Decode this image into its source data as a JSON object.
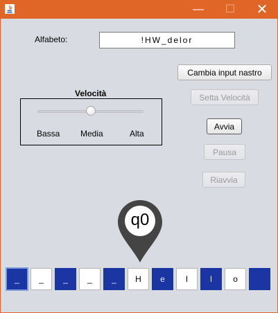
{
  "window": {
    "minimize_glyph": "—",
    "maximize_glyph": "☐",
    "close_glyph": "✕",
    "titlebar_color": "#e06627"
  },
  "alphabet": {
    "label": "Alfabeto:",
    "value": "!HW_delor"
  },
  "buttons": {
    "change_tape": "Cambia input nastro",
    "set_speed": "Setta Velocità",
    "start": "Avvia",
    "pause": "Pausa",
    "restart": "Riavvia"
  },
  "speed": {
    "title": "Velocità",
    "low": "Bassa",
    "medium": "Media",
    "high": "Alta",
    "level_fraction": 0.5
  },
  "state": {
    "name": "q0",
    "pin_color": "#444444"
  },
  "tape": {
    "cells": [
      {
        "symbol": "_",
        "style": "blue",
        "active": true
      },
      {
        "symbol": "_",
        "style": "white",
        "active": false
      },
      {
        "symbol": "_",
        "style": "blue",
        "active": false
      },
      {
        "symbol": "_",
        "style": "white",
        "active": false
      },
      {
        "symbol": "_",
        "style": "blue",
        "active": false
      },
      {
        "symbol": "H",
        "style": "white",
        "active": false
      },
      {
        "symbol": "e",
        "style": "blue",
        "active": false
      },
      {
        "symbol": "l",
        "style": "white",
        "active": false
      },
      {
        "symbol": "l",
        "style": "blue",
        "active": false
      },
      {
        "symbol": "o",
        "style": "white",
        "active": false
      },
      {
        "symbol": "",
        "style": "blue",
        "active": false
      }
    ],
    "blue_color": "#1b35a3"
  }
}
